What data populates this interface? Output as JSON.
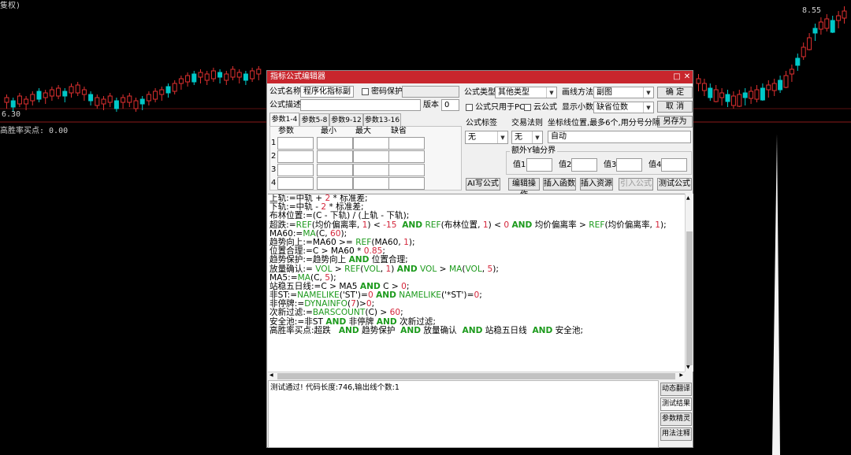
{
  "chart": {
    "top_left_label": "隻权)",
    "top_right_value": "8.55",
    "bottom_left_value": "6.30",
    "indicator_label": "高胜率买点: 0.00",
    "up_color": "#e03030",
    "down_color": "#00c8c8",
    "axis_line_color": "#8b1a1a"
  },
  "dialog": {
    "title": "指标公式编辑器",
    "win_restore": "□",
    "win_close": "✕",
    "name_label": "公式名称",
    "name_value": "程序化指标副",
    "password_label": "密码保护",
    "desc_label": "公式描述",
    "version_label": "版本",
    "version_value": "0",
    "type_label": "公式类型",
    "type_value": "其他类型",
    "draw_label": "画线方法",
    "draw_value": "副图",
    "ok_button": "确  定",
    "cancel_button": "取  消",
    "saveas_button": "另存为",
    "pc_only_label": "公式只用于PC",
    "cloud_label": "云公式",
    "decimals_label": "显示小数",
    "decimals_value": "缺省位数",
    "tabs": [
      "参数1-4",
      "参数5-8",
      "参数9-12",
      "参数13-16"
    ],
    "param_headers": [
      "参数",
      "最小",
      "最大",
      "缺省"
    ],
    "param_rows": [
      "1",
      "2",
      "3",
      "4"
    ],
    "formula_tag_label": "公式标签",
    "formula_tag_value": "无",
    "trade_rule_label": "交易法则",
    "trade_rule_value": "无",
    "coord_label": "坐标线位置,最多6个,用分号分隔",
    "coord_value": "自动",
    "yaxis_group": "额外Y轴分界",
    "yaxis_values": [
      "值1",
      "值2",
      "值3",
      "值4"
    ],
    "ai_button": "AI写公式",
    "edit_button": "编辑操作",
    "insert_func_button": "插入函数",
    "insert_res_button": "插入资源",
    "import_button": "引入公式",
    "test_button": "测试公式",
    "status_text": "测试通过! 代码长度:746,输出线个数:1",
    "side_buttons": [
      "动态翻译",
      "测试结果",
      "参数精灵",
      "用法注释"
    ]
  },
  "code_lines": [
    [
      [
        "t",
        "上轨:=中轨 + "
      ],
      [
        "n",
        "2"
      ],
      [
        "t",
        " * 标准差;"
      ]
    ],
    [
      [
        "t",
        "下轨:=中轨 - "
      ],
      [
        "n",
        "2"
      ],
      [
        "t",
        " * 标准差;"
      ]
    ],
    [
      [
        "t",
        "布林位置:=(C - 下轨) / (上轨 - 下轨);"
      ]
    ],
    [
      [
        "t",
        "超跌:="
      ],
      [
        "f",
        "REF"
      ],
      [
        "t",
        "(均价偏离率, "
      ],
      [
        "n",
        "1"
      ],
      [
        "t",
        ") < "
      ],
      [
        "n",
        "-15"
      ],
      [
        "t",
        "  "
      ],
      [
        "k",
        "AND"
      ],
      [
        "t",
        " "
      ],
      [
        "f",
        "REF"
      ],
      [
        "t",
        "(布林位置, "
      ],
      [
        "n",
        "1"
      ],
      [
        "t",
        ") < "
      ],
      [
        "n",
        "0"
      ],
      [
        "t",
        " "
      ],
      [
        "k",
        "AND"
      ],
      [
        "t",
        " 均价偏离率 > "
      ],
      [
        "f",
        "REF"
      ],
      [
        "t",
        "(均价偏离率, "
      ],
      [
        "n",
        "1"
      ],
      [
        "t",
        ");"
      ]
    ],
    [
      [
        "t",
        "MA60:="
      ],
      [
        "f",
        "MA"
      ],
      [
        "t",
        "(C, "
      ],
      [
        "n",
        "60"
      ],
      [
        "t",
        ");"
      ]
    ],
    [
      [
        "t",
        "趋势向上:=MA60 >= "
      ],
      [
        "f",
        "REF"
      ],
      [
        "t",
        "(MA60, "
      ],
      [
        "n",
        "1"
      ],
      [
        "t",
        ");"
      ]
    ],
    [
      [
        "t",
        "位置合理:=C > MA60 * "
      ],
      [
        "n",
        "0.85"
      ],
      [
        "t",
        ";"
      ]
    ],
    [
      [
        "t",
        "趋势保护:=趋势向上 "
      ],
      [
        "k",
        "AND"
      ],
      [
        "t",
        " 位置合理;"
      ]
    ],
    [
      [
        "t",
        "放量确认:= "
      ],
      [
        "f",
        "VOL"
      ],
      [
        "t",
        " > "
      ],
      [
        "f",
        "REF"
      ],
      [
        "t",
        "("
      ],
      [
        "f",
        "VOL"
      ],
      [
        "t",
        ", "
      ],
      [
        "n",
        "1"
      ],
      [
        "t",
        ") "
      ],
      [
        "k",
        "AND"
      ],
      [
        "t",
        " "
      ],
      [
        "f",
        "VOL"
      ],
      [
        "t",
        " > "
      ],
      [
        "f",
        "MA"
      ],
      [
        "t",
        "("
      ],
      [
        "f",
        "VOL"
      ],
      [
        "t",
        ", "
      ],
      [
        "n",
        "5"
      ],
      [
        "t",
        ");"
      ]
    ],
    [
      [
        "t",
        "MA5:="
      ],
      [
        "f",
        "MA"
      ],
      [
        "t",
        "(C, "
      ],
      [
        "n",
        "5"
      ],
      [
        "t",
        ");"
      ]
    ],
    [
      [
        "t",
        "站稳五日线:=C > MA5 "
      ],
      [
        "k",
        "AND"
      ],
      [
        "t",
        " C > "
      ],
      [
        "n",
        "0"
      ],
      [
        "t",
        ";"
      ]
    ],
    [
      [
        "t",
        "非ST:="
      ],
      [
        "f",
        "NAMELIKE"
      ],
      [
        "t",
        "('ST')="
      ],
      [
        "n",
        "0"
      ],
      [
        "t",
        " "
      ],
      [
        "k",
        "AND"
      ],
      [
        "t",
        " "
      ],
      [
        "f",
        "NAMELIKE"
      ],
      [
        "t",
        "('*ST')="
      ],
      [
        "n",
        "0"
      ],
      [
        "t",
        ";"
      ]
    ],
    [
      [
        "t",
        "非停牌:="
      ],
      [
        "f",
        "DYNAINFO"
      ],
      [
        "t",
        "("
      ],
      [
        "n",
        "7"
      ],
      [
        "t",
        ")>"
      ],
      [
        "n",
        "0"
      ],
      [
        "t",
        ";"
      ]
    ],
    [
      [
        "t",
        "次新过滤:="
      ],
      [
        "f",
        "BARSCOUNT"
      ],
      [
        "t",
        "(C) > "
      ],
      [
        "n",
        "60"
      ],
      [
        "t",
        ";"
      ]
    ],
    [
      [
        "t",
        "安全池:=非ST "
      ],
      [
        "k",
        "AND"
      ],
      [
        "t",
        " 非停牌 "
      ],
      [
        "k",
        "AND"
      ],
      [
        "t",
        " 次新过滤;"
      ]
    ],
    [
      [
        "t",
        "高胜率买点:超跌   "
      ],
      [
        "k",
        "AND"
      ],
      [
        "t",
        " 趋势保护  "
      ],
      [
        "k",
        "AND"
      ],
      [
        "t",
        " 放量确认  "
      ],
      [
        "k",
        "AND"
      ],
      [
        "t",
        " 站稳五日线  "
      ],
      [
        "k",
        "AND"
      ],
      [
        "t",
        " 安全池;"
      ]
    ]
  ]
}
